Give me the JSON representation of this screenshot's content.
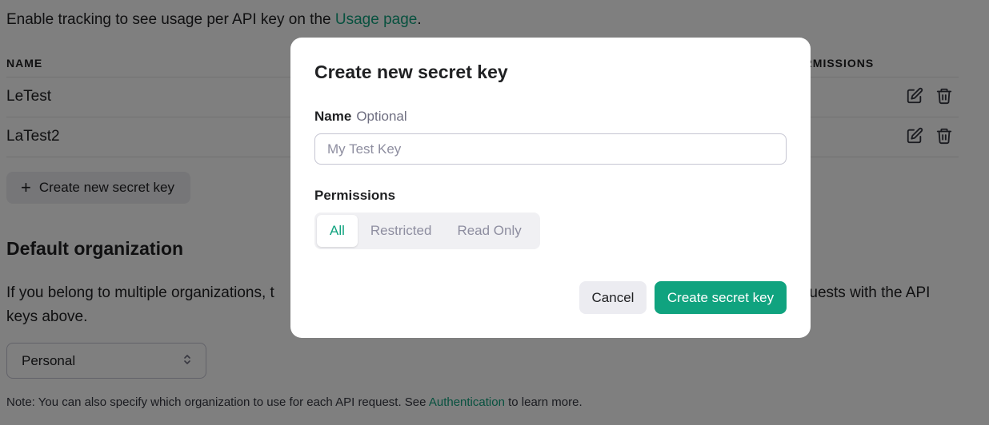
{
  "background": {
    "tracking_prefix": "Enable tracking to see usage per API key on the ",
    "tracking_link": "Usage page",
    "tracking_suffix": ".",
    "table": {
      "col_name": "NAME",
      "col_permissions": "PERMISSIONS",
      "rows": [
        {
          "name": "LeTest"
        },
        {
          "name": "LaTest2"
        }
      ]
    },
    "create_button_label": "Create new secret key",
    "default_org": {
      "title": "Default organization",
      "description_start": "If you belong to multiple organizations, t",
      "description_end": "quests with the API",
      "description_line2": "keys above.",
      "select_value": "Personal"
    },
    "note_prefix": "Note: You can also specify which organization to use for each API request. See ",
    "note_link": "Authentication",
    "note_suffix": " to learn more."
  },
  "modal": {
    "title": "Create new secret key",
    "name_label": "Name",
    "name_optional": "Optional",
    "name_placeholder": "My Test Key",
    "permissions_label": "Permissions",
    "permission_options": [
      "All",
      "Restricted",
      "Read Only"
    ],
    "selected_permission": "All",
    "cancel_label": "Cancel",
    "submit_label": "Create secret key"
  },
  "colors": {
    "accent": "#10a37f",
    "overlay": "rgba(0,0,0,0.5)"
  },
  "icons": {
    "edit": "edit-icon",
    "delete": "trash-icon",
    "add": "plus-icon",
    "select": "chevron-up-down-icon"
  }
}
